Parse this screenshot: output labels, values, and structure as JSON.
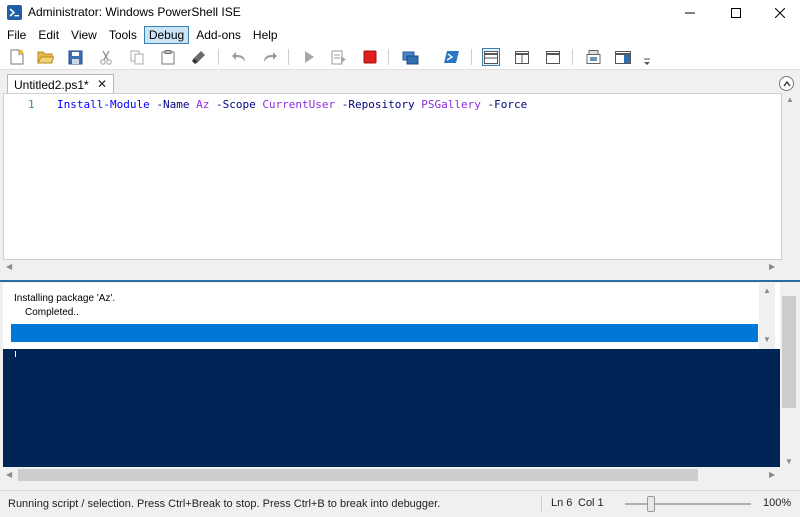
{
  "window": {
    "title": "Administrator: Windows PowerShell ISE"
  },
  "menu": [
    "File",
    "Edit",
    "View",
    "Tools",
    "Debug",
    "Add-ons",
    "Help"
  ],
  "menu_active": "Debug",
  "toolbar_icons": [
    "new-script-icon",
    "open-script-icon",
    "save-script-icon",
    "cut-icon",
    "copy-icon",
    "paste-icon",
    "clear-console-icon",
    "undo-icon",
    "redo-icon",
    "run-script-icon",
    "run-selection-icon",
    "stop-operation-icon",
    "new-remote-tab-icon",
    "start-powershell-icon",
    "show-script-top-icon",
    "show-script-right-icon",
    "show-script-maximized-icon",
    "show-commands-icon",
    "show-command-addon-icon"
  ],
  "colors": {
    "console_background": "#012456",
    "progress_fill": "#0078d7",
    "stop_button": "#e01e1e",
    "menu_active_bg": "#cce4f7"
  },
  "tab": {
    "label": "Untitled2.ps1*",
    "close": "✕"
  },
  "editor": {
    "line_number": "1",
    "code": {
      "cmd": "Install-Module",
      "p1": " -Name ",
      "a1": "Az",
      "p2": " -Scope ",
      "a2": "CurrentUser",
      "p3": " -Repository ",
      "a3": "PSGallery",
      "p4": " -Force"
    }
  },
  "console": {
    "progress_activity": "Installing package 'Az'.",
    "progress_status": "Completed..",
    "progress_fraction": 1.0
  },
  "status": {
    "message": "Running script / selection.  Press Ctrl+Break to stop.  Press Ctrl+B to break into debugger.",
    "ln": "Ln 6",
    "col": "Col 1",
    "zoom": "100%"
  }
}
